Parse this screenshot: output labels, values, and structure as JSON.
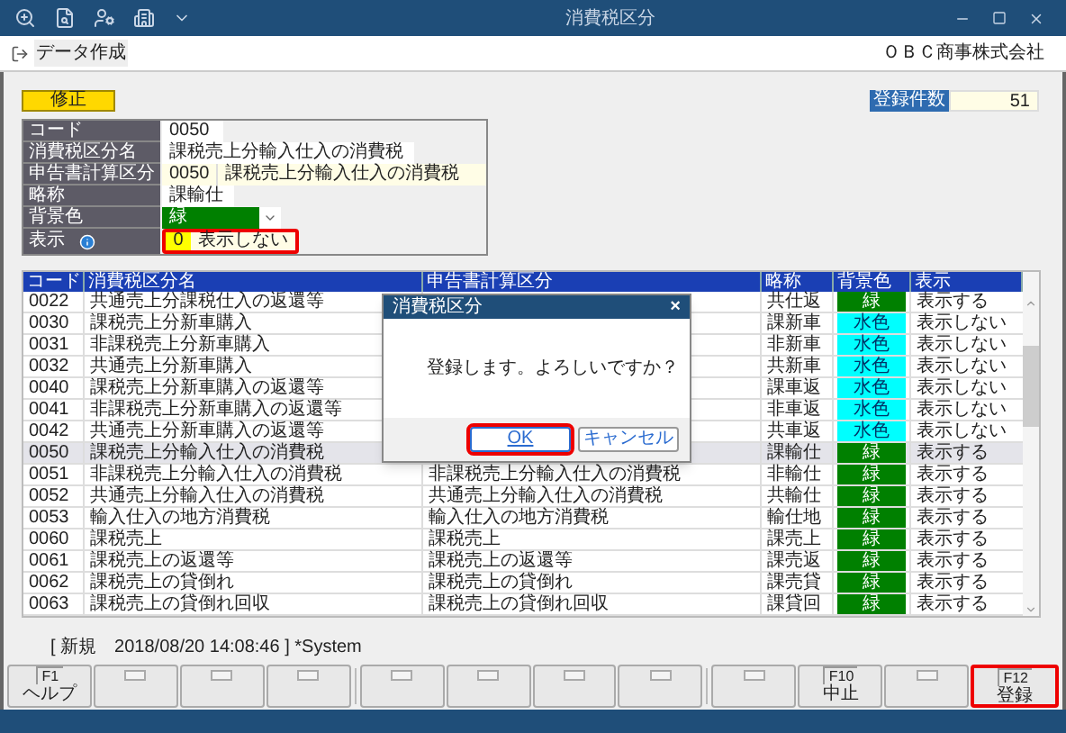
{
  "window": {
    "title": "消費税区分"
  },
  "menu_bar": {
    "item": "データ作成",
    "company": "ＯＢＣ商事株式会社"
  },
  "mode_badge": "修正",
  "record_count": {
    "label": "登録件数",
    "value": "51"
  },
  "form": [
    {
      "kind": "text",
      "label": "コード",
      "value": "0050"
    },
    {
      "kind": "text",
      "label": "消費税区分名",
      "value": "課税売上分輸入仕入の消費税"
    },
    {
      "kind": "pair",
      "label": "申告書計算区分",
      "code": "0050",
      "value": "課税売上分輸入仕入の消費税"
    },
    {
      "kind": "text",
      "label": "略称",
      "value": "課輸仕"
    },
    {
      "kind": "color",
      "label": "背景色",
      "value": "緑",
      "color": "#008000"
    },
    {
      "kind": "pair_info",
      "label": "表示",
      "code": "0",
      "value": "表示しない",
      "highlighted": true
    }
  ],
  "table": {
    "columns": [
      "コード",
      "消費税区分名",
      "申告書計算区分",
      "略称",
      "背景色",
      "表示"
    ],
    "rows": [
      {
        "code": "0022",
        "name": "共通売上分課税仕入の返還等",
        "abbr": "共仕返",
        "bg": "緑",
        "color": "#008000",
        "display": "表示する",
        "selected": false
      },
      {
        "code": "0030",
        "name": "課税売上分新車購入",
        "abbr": "課新車",
        "bg": "水色",
        "color": "#00ffff",
        "display": "表示しない",
        "selected": false
      },
      {
        "code": "0031",
        "name": "非課税売上分新車購入",
        "abbr": "非新車",
        "bg": "水色",
        "color": "#00ffff",
        "display": "表示しない",
        "selected": false
      },
      {
        "code": "0032",
        "name": "共通売上分新車購入",
        "abbr": "共新車",
        "bg": "水色",
        "color": "#00ffff",
        "display": "表示しない",
        "selected": false
      },
      {
        "code": "0040",
        "name": "課税売上分新車購入の返還等",
        "abbr": "課車返",
        "bg": "水色",
        "color": "#00ffff",
        "display": "表示しない",
        "selected": false
      },
      {
        "code": "0041",
        "name": "非課税売上分新車購入の返還等",
        "abbr": "非車返",
        "bg": "水色",
        "color": "#00ffff",
        "display": "表示しない",
        "selected": false
      },
      {
        "code": "0042",
        "name": "共通売上分新車購入の返還等",
        "abbr": "共車返",
        "bg": "水色",
        "color": "#00ffff",
        "display": "表示しない",
        "selected": false
      },
      {
        "code": "0050",
        "name": "課税売上分輸入仕入の消費税",
        "abbr": "課輸仕",
        "bg": "緑",
        "color": "#008000",
        "display": "表示する",
        "selected": true
      },
      {
        "code": "0051",
        "name": "非課税売上分輸入仕入の消費税",
        "calc": "非課税売上分輸入仕入の消費税",
        "abbr": "非輸仕",
        "bg": "緑",
        "color": "#008000",
        "display": "表示する",
        "selected": false
      },
      {
        "code": "0052",
        "name": "共通売上分輸入仕入の消費税",
        "calc": "共通売上分輸入仕入の消費税",
        "abbr": "共輸仕",
        "bg": "緑",
        "color": "#008000",
        "display": "表示する",
        "selected": false
      },
      {
        "code": "0053",
        "name": "輸入仕入の地方消費税",
        "calc": "輸入仕入の地方消費税",
        "abbr": "輸仕地",
        "bg": "緑",
        "color": "#008000",
        "display": "表示する",
        "selected": false
      },
      {
        "code": "0060",
        "name": "課税売上",
        "calc": "課税売上",
        "abbr": "課売上",
        "bg": "緑",
        "color": "#008000",
        "display": "表示する",
        "selected": false
      },
      {
        "code": "0061",
        "name": "課税売上の返還等",
        "calc": "課税売上の返還等",
        "abbr": "課売返",
        "bg": "緑",
        "color": "#008000",
        "display": "表示する",
        "selected": false
      },
      {
        "code": "0062",
        "name": "課税売上の貸倒れ",
        "calc": "課税売上の貸倒れ",
        "abbr": "課売貸",
        "bg": "緑",
        "color": "#008000",
        "display": "表示する",
        "selected": false
      },
      {
        "code": "0063",
        "name": "課税売上の貸倒れ回収",
        "calc": "課税売上の貸倒れ回収",
        "abbr": "課貸回",
        "bg": "緑",
        "color": "#008000",
        "display": "表示する",
        "selected": false
      }
    ]
  },
  "status": "[ 新規　2018/08/20 14:08:46 ] *System",
  "dialog": {
    "title": "消費税区分",
    "close": "×",
    "message": "登録します。よろしいですか？",
    "buttons": [
      {
        "label": "OK",
        "highlighted": true
      },
      {
        "label": "キャンセル",
        "highlighted": false
      }
    ]
  },
  "function_keys": [
    {
      "key": "F1",
      "label": "ヘルプ",
      "highlighted": false
    },
    {
      "highlighted": false
    },
    {
      "highlighted": false
    },
    {
      "highlighted": false
    },
    {
      "highlighted": false
    },
    {
      "highlighted": false
    },
    {
      "highlighted": false
    },
    {
      "highlighted": false
    },
    {
      "highlighted": false
    },
    {
      "key": "F10",
      "label": "中止",
      "highlighted": false
    },
    {
      "highlighted": false
    },
    {
      "key": "F12",
      "label": "登録",
      "highlighted": true
    }
  ]
}
